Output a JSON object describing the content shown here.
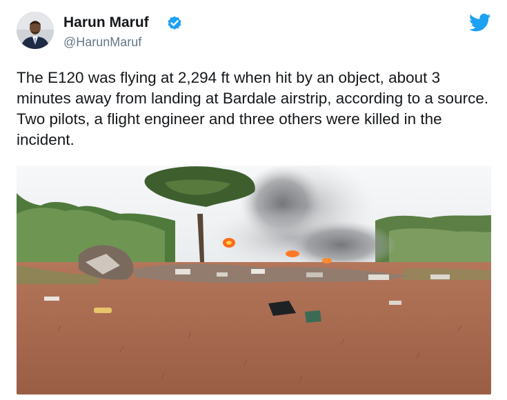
{
  "author": {
    "display_name": "Harun Maruf",
    "handle": "@HarunMaruf",
    "verified": true,
    "avatar_icon": "profile-photo"
  },
  "brand": {
    "icon": "twitter-bird-icon",
    "color": "#1da1f2"
  },
  "tweet": {
    "text": "The E120 was flying at 2,294 ft when hit by an object, about 3 minutes away from landing at Bardale airstrip, according to a source. Two pilots, a flight engineer and three others were killed in the incident."
  },
  "colors": {
    "verified_badge": "#1da1f2",
    "handle_text": "#657786",
    "body_text": "#14171a"
  }
}
